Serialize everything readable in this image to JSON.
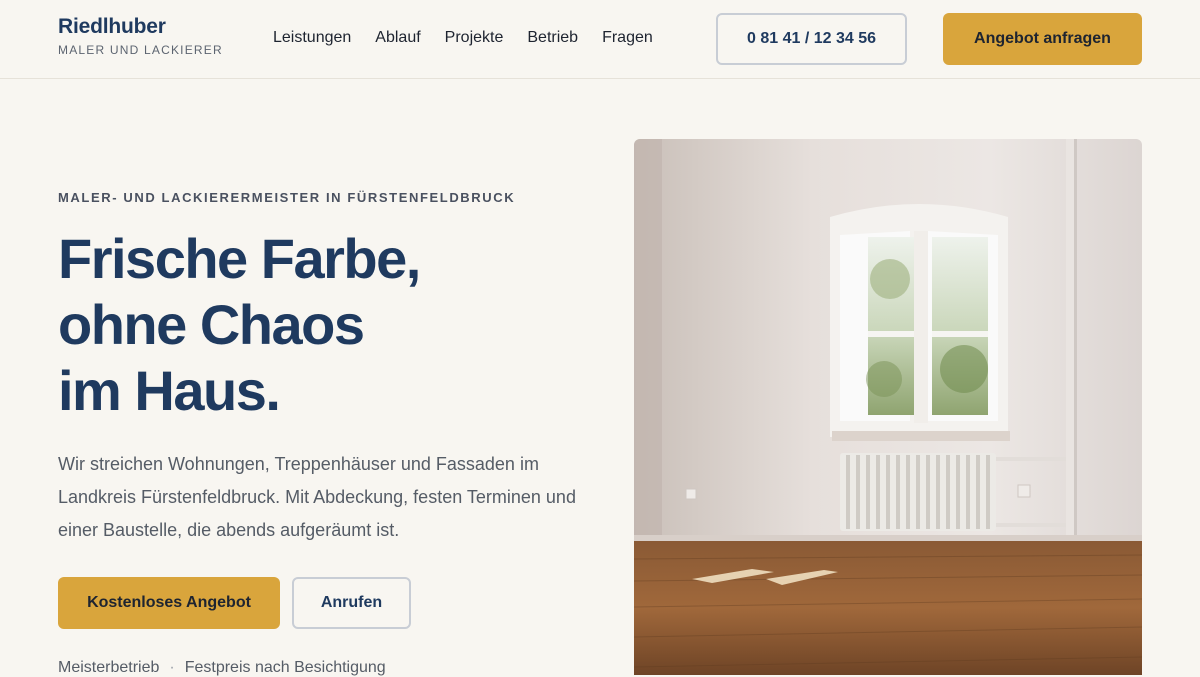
{
  "brand": {
    "name": "Riedlhuber",
    "tagline": "MALER UND LACKIERER"
  },
  "nav": {
    "items": [
      {
        "label": "Leistungen"
      },
      {
        "label": "Ablauf"
      },
      {
        "label": "Projekte"
      },
      {
        "label": "Betrieb"
      },
      {
        "label": "Fragen"
      }
    ]
  },
  "header": {
    "phone_label": "0 81 41 / 12 34 56",
    "cta_label": "Angebot anfragen"
  },
  "hero": {
    "eyebrow": "MALER- UND LACKIERERMEISTER IN FÜRSTENFELDBRUCK",
    "headline": [
      "Frische Farbe,",
      "ohne Chaos",
      "im Haus."
    ],
    "lead": "Wir streichen Wohnungen, Treppenhäuser und Fassaden im Landkreis Fürstenfeldbruck. Mit Abdeckung, festen Terminen und einer Baustelle, die abends aufgeräumt ist.",
    "primary_button": "Kostenloses Angebot",
    "secondary_button": "Anrufen",
    "trust_items": [
      "Meisterbetrieb",
      "Festpreis nach Besichtigung"
    ],
    "trust_separator": "·"
  },
  "colors": {
    "accent": "#d9a53c",
    "brand_navy": "#1f3a5f",
    "background": "#f8f6f1"
  },
  "icons": {
    "photo": "room-photo"
  }
}
